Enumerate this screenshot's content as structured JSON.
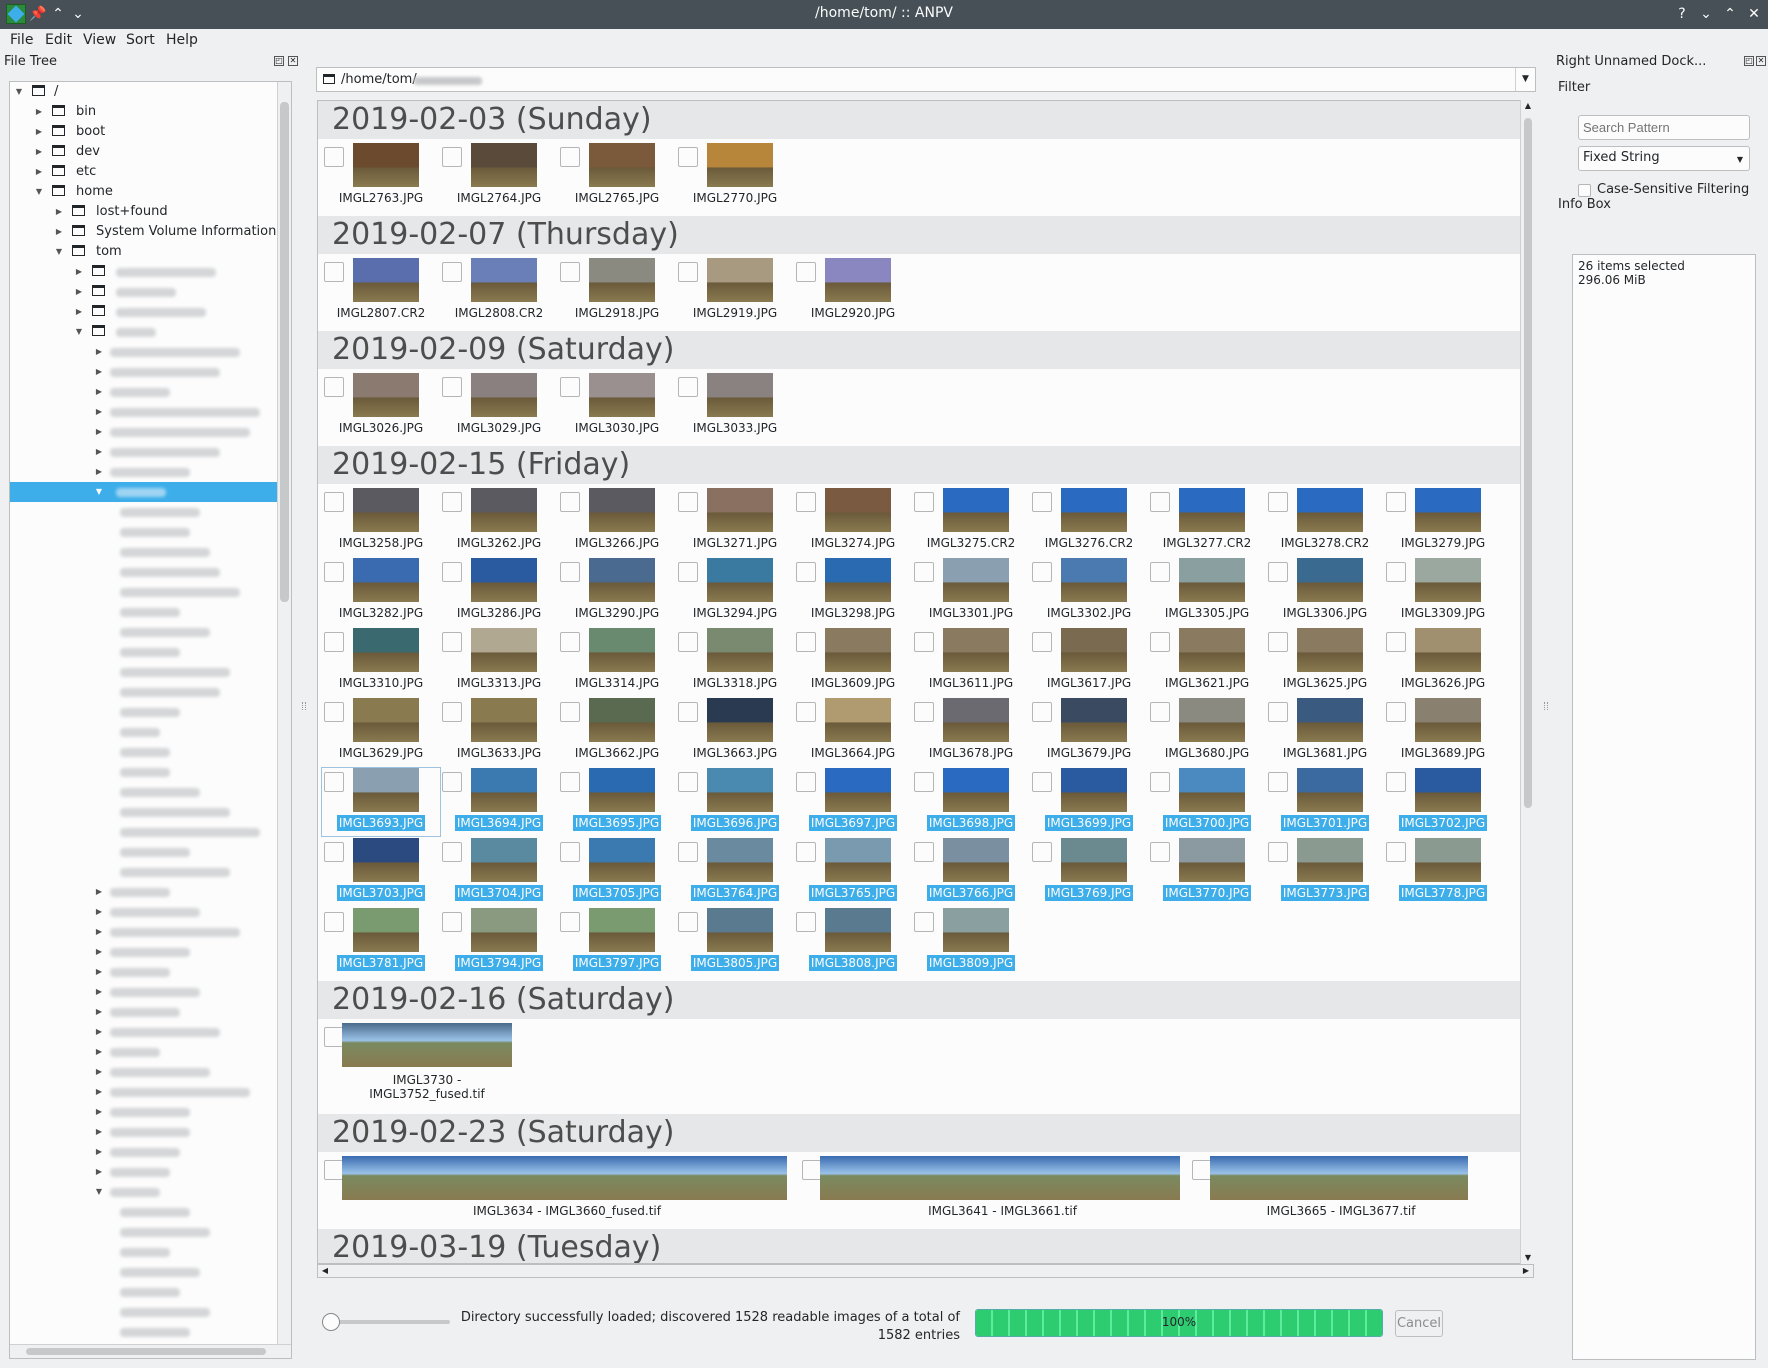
{
  "window": {
    "title": "/home/tom/ :: ANPV"
  },
  "menu": [
    "File",
    "Edit",
    "View",
    "Sort",
    "Help"
  ],
  "file_tree": {
    "dock_title": "File Tree",
    "items": [
      {
        "label": "/",
        "indent": 0,
        "expanded": true
      },
      {
        "label": "bin",
        "indent": 1,
        "expanded": false
      },
      {
        "label": "boot",
        "indent": 1,
        "expanded": false
      },
      {
        "label": "dev",
        "indent": 1,
        "expanded": false
      },
      {
        "label": "etc",
        "indent": 1,
        "expanded": false
      },
      {
        "label": "home",
        "indent": 1,
        "expanded": true
      },
      {
        "label": "lost+found",
        "indent": 2,
        "expanded": false
      },
      {
        "label": "System Volume Information",
        "indent": 2,
        "expanded": false
      },
      {
        "label": "tom",
        "indent": 2,
        "expanded": true
      }
    ]
  },
  "path_bar": {
    "text": "/home/tom/"
  },
  "sections": [
    {
      "heading": "2019-02-03 (Sunday)",
      "rows": [
        [
          {
            "name": "IMGL2763.JPG",
            "color": "#6b4a2e",
            "sel": false
          },
          {
            "name": "IMGL2764.JPG",
            "color": "#5a4a3a",
            "sel": false
          },
          {
            "name": "IMGL2765.JPG",
            "color": "#7a5a3a",
            "sel": false
          },
          {
            "name": "IMGL2770.JPG",
            "color": "#b8863a",
            "sel": false
          }
        ]
      ]
    },
    {
      "heading": "2019-02-07 (Thursday)",
      "rows": [
        [
          {
            "name": "IMGL2807.CR2",
            "color": "#5a6eae",
            "sel": false
          },
          {
            "name": "IMGL2808.CR2",
            "color": "#6a7eb8",
            "sel": false
          },
          {
            "name": "IMGL2918.JPG",
            "color": "#8a8a80",
            "sel": false
          },
          {
            "name": "IMGL2919.JPG",
            "color": "#a89a80",
            "sel": false
          },
          {
            "name": "IMGL2920.JPG",
            "color": "#8a86c0",
            "sel": false
          }
        ]
      ]
    },
    {
      "heading": "2019-02-09 (Saturday)",
      "rows": [
        [
          {
            "name": "IMGL3026.JPG",
            "color": "#8a7a70",
            "sel": false
          },
          {
            "name": "IMGL3029.JPG",
            "color": "#8a8080",
            "sel": false
          },
          {
            "name": "IMGL3030.JPG",
            "color": "#9a9090",
            "sel": false
          },
          {
            "name": "IMGL3033.JPG",
            "color": "#8a8280",
            "sel": false
          }
        ]
      ]
    },
    {
      "heading": "2019-02-15 (Friday)",
      "rows": [
        [
          {
            "name": "IMGL3258.JPG",
            "color": "#5a5a60",
            "sel": false
          },
          {
            "name": "IMGL3262.JPG",
            "color": "#5a5a60",
            "sel": false
          },
          {
            "name": "IMGL3266.JPG",
            "color": "#5a5a60",
            "sel": false
          },
          {
            "name": "IMGL3271.JPG",
            "color": "#8a7060",
            "sel": false
          },
          {
            "name": "IMGL3274.JPG",
            "color": "#7a5a40",
            "sel": false
          },
          {
            "name": "IMGL3275.CR2",
            "color": "#2a6ac0",
            "sel": false
          },
          {
            "name": "IMGL3276.CR2",
            "color": "#2a6ac0",
            "sel": false
          },
          {
            "name": "IMGL3277.CR2",
            "color": "#2a6ac0",
            "sel": false
          },
          {
            "name": "IMGL3278.CR2",
            "color": "#2a6ac0",
            "sel": false
          },
          {
            "name": "IMGL3279.JPG",
            "color": "#2a6ac0",
            "sel": false
          }
        ],
        [
          {
            "name": "IMGL3282.JPG",
            "color": "#3a6ab0",
            "sel": false
          },
          {
            "name": "IMGL3286.JPG",
            "color": "#2a5aa0",
            "sel": false
          },
          {
            "name": "IMGL3290.JPG",
            "color": "#4a6a90",
            "sel": false
          },
          {
            "name": "IMGL3294.JPG",
            "color": "#3a7aa0",
            "sel": false
          },
          {
            "name": "IMGL3298.JPG",
            "color": "#2a6ab0",
            "sel": false
          },
          {
            "name": "IMGL3301.JPG",
            "color": "#8aa0b0",
            "sel": false
          },
          {
            "name": "IMGL3302.JPG",
            "color": "#4a7ab0",
            "sel": false
          },
          {
            "name": "IMGL3305.JPG",
            "color": "#8aa0a0",
            "sel": false
          },
          {
            "name": "IMGL3306.JPG",
            "color": "#3a6a90",
            "sel": false
          },
          {
            "name": "IMGL3309.JPG",
            "color": "#9aa8a0",
            "sel": false
          }
        ],
        [
          {
            "name": "IMGL3310.JPG",
            "color": "#3a6a70",
            "sel": false
          },
          {
            "name": "IMGL3313.JPG",
            "color": "#b0a890",
            "sel": false
          },
          {
            "name": "IMGL3314.JPG",
            "color": "#6a8a70",
            "sel": false
          },
          {
            "name": "IMGL3318.JPG",
            "color": "#7a8a70",
            "sel": false
          },
          {
            "name": "IMGL3609.JPG",
            "color": "#8a7a60",
            "sel": false
          },
          {
            "name": "IMGL3611.JPG",
            "color": "#8a7a60",
            "sel": false
          },
          {
            "name": "IMGL3617.JPG",
            "color": "#7a6a50",
            "sel": false
          },
          {
            "name": "IMGL3621.JPG",
            "color": "#8a7a60",
            "sel": false
          },
          {
            "name": "IMGL3625.JPG",
            "color": "#8a7a60",
            "sel": false
          },
          {
            "name": "IMGL3626.JPG",
            "color": "#a09070",
            "sel": false
          }
        ],
        [
          {
            "name": "IMGL3629.JPG",
            "color": "#8a7a50",
            "sel": false
          },
          {
            "name": "IMGL3633.JPG",
            "color": "#8a7a50",
            "sel": false
          },
          {
            "name": "IMGL3662.JPG",
            "color": "#5a6a50",
            "sel": false
          },
          {
            "name": "IMGL3663.JPG",
            "color": "#2a3a50",
            "sel": false
          },
          {
            "name": "IMGL3664.JPG",
            "color": "#b09a70",
            "sel": false
          },
          {
            "name": "IMGL3678.JPG",
            "color": "#6a6a70",
            "sel": false
          },
          {
            "name": "IMGL3679.JPG",
            "color": "#3a4a60",
            "sel": false
          },
          {
            "name": "IMGL3680.JPG",
            "color": "#8a8a80",
            "sel": false
          },
          {
            "name": "IMGL3681.JPG",
            "color": "#3a5a80",
            "sel": false
          },
          {
            "name": "IMGL3689.JPG",
            "color": "#8a8070",
            "sel": false
          }
        ],
        [
          {
            "name": "IMGL3693.JPG",
            "color": "#8aa0b0",
            "sel": true
          },
          {
            "name": "IMGL3694.JPG",
            "color": "#3a7ab0",
            "sel": true
          },
          {
            "name": "IMGL3695.JPG",
            "color": "#2a6ab0",
            "sel": true
          },
          {
            "name": "IMGL3696.JPG",
            "color": "#4a8ab0",
            "sel": true
          },
          {
            "name": "IMGL3697.JPG",
            "color": "#2a6ac0",
            "sel": true
          },
          {
            "name": "IMGL3698.JPG",
            "color": "#2a6ac0",
            "sel": true
          },
          {
            "name": "IMGL3699.JPG",
            "color": "#2a5aa0",
            "sel": true
          },
          {
            "name": "IMGL3700.JPG",
            "color": "#4a8ac0",
            "sel": true
          },
          {
            "name": "IMGL3701.JPG",
            "color": "#3a6aa0",
            "sel": true
          },
          {
            "name": "IMGL3702.JPG",
            "color": "#2a5aa0",
            "sel": true
          }
        ],
        [
          {
            "name": "IMGL3703.JPG",
            "color": "#2a4a80",
            "sel": true
          },
          {
            "name": "IMGL3704.JPG",
            "color": "#5a8aa0",
            "sel": true
          },
          {
            "name": "IMGL3705.JPG",
            "color": "#3a7ab0",
            "sel": true
          },
          {
            "name": "IMGL3764.JPG",
            "color": "#6a8aa0",
            "sel": true
          },
          {
            "name": "IMGL3765.JPG",
            "color": "#7a9ab0",
            "sel": true
          },
          {
            "name": "IMGL3766.JPG",
            "color": "#7a90a0",
            "sel": true
          },
          {
            "name": "IMGL3769.JPG",
            "color": "#6a8a90",
            "sel": true
          },
          {
            "name": "IMGL3770.JPG",
            "color": "#8a9aa0",
            "sel": true
          },
          {
            "name": "IMGL3773.JPG",
            "color": "#8a9a90",
            "sel": true
          },
          {
            "name": "IMGL3778.JPG",
            "color": "#8a9a90",
            "sel": true
          }
        ],
        [
          {
            "name": "IMGL3781.JPG",
            "color": "#7a9a70",
            "sel": true
          },
          {
            "name": "IMGL3794.JPG",
            "color": "#8a9a80",
            "sel": true
          },
          {
            "name": "IMGL3797.JPG",
            "color": "#7a9a70",
            "sel": true
          },
          {
            "name": "IMGL3805.JPG",
            "color": "#5a7a90",
            "sel": true
          },
          {
            "name": "IMGL3808.JPG",
            "color": "#5a7a90",
            "sel": true
          },
          {
            "name": "IMGL3809.JPG",
            "color": "#8aa0a0",
            "sel": true
          }
        ]
      ]
    },
    {
      "heading": "2019-02-16 (Saturday)",
      "wide": [
        {
          "name_line1": "IMGL3730 -",
          "name_line2": "IMGL3752_fused.tif",
          "color": "#4a6a8a"
        }
      ]
    },
    {
      "heading": "2019-02-23 (Saturday)",
      "wide": [
        {
          "name_line1": "IMGL3634 - IMGL3660_fused.tif",
          "color": "#3a6ab0"
        },
        {
          "name_line1": "IMGL3641 - IMGL3661.tif",
          "color": "#3a6ab0"
        },
        {
          "name_line1": "IMGL3665 - IMGL3677.tif",
          "color": "#3a6ab0"
        }
      ]
    },
    {
      "heading": "2019-03-19 (Tuesday)"
    }
  ],
  "status": {
    "line1": "Directory successfully loaded; discovered 1528 readable images of a total of",
    "line2": "1582 entries",
    "progress_text": "100%",
    "progress": 1.0,
    "cancel_label": "Cancel"
  },
  "right_dock": {
    "title": "Right Unnamed Dock...",
    "filter_label": "Filter",
    "search_placeholder": "Search Pattern",
    "filter_mode": "Fixed String",
    "case_label": "Case-Sensitive Filtering",
    "info_label": "Info Box",
    "info_line1": "26 items selected",
    "info_line2": "296.06 MiB"
  }
}
